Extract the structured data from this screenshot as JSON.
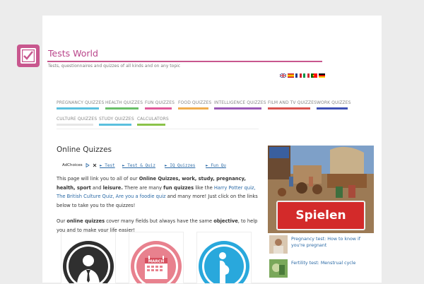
{
  "site": {
    "title": "Tests World",
    "tagline": "Tests, questionnaires and quizzes of all kinds and on any topic"
  },
  "colors": {
    "brand": "#c8578e",
    "link": "#2b6aa6",
    "ad_button": "#d32a2a"
  },
  "languages": [
    "en",
    "es",
    "fr",
    "it",
    "pt",
    "de"
  ],
  "nav": [
    {
      "label": "PREGNANCY QUIZZES",
      "color": "#5bc0de"
    },
    {
      "label": "HEALTH QUIZZES",
      "color": "#6abf69"
    },
    {
      "label": "FUN QUIZZES",
      "color": "#e05a9b"
    },
    {
      "label": "FOOD QUIZZES",
      "color": "#f0ad4e"
    },
    {
      "label": "INTELLIGENCE QUIZZES",
      "color": "#9b59b6"
    },
    {
      "label": "FILM AND TV QUIZZES",
      "color": "#d9534f"
    },
    {
      "label": "WORK QUIZZES",
      "color": "#3f51b5"
    },
    {
      "label": "CULTURE QUIZZES",
      "color": "#e6e6e6"
    },
    {
      "label": "STUDY QUIZZES",
      "color": "#5bc0de"
    },
    {
      "label": "CALCULATORS",
      "color": "#8bc34a"
    }
  ],
  "main": {
    "heading": "Online Quizzes",
    "adchoices": "AdChoices",
    "ad_links": [
      "► Test",
      "► Test & Quiz",
      "► IQ Quizzes",
      "► Fun Qu"
    ],
    "intro": {
      "t1": "This page will link you to all of our ",
      "b1": "Online Quizzes, work, study, pregnancy, health, sport",
      "t2": " and ",
      "b2": "leisure.",
      "t3": " There are many ",
      "b3": "fun quizzes",
      "t4": " like the ",
      "l1": "Harry Potter quiz, The British Culture Quiz, Are you a foodie quiz",
      "t5": " and many more! Just click on the links below to take you to the quizzes!"
    },
    "para2": {
      "t1": "Our ",
      "b1": "online quizzes",
      "t2": " cover many fields but always have the same ",
      "b2": "objective",
      "t3": ", to help you and to make your life easier!"
    },
    "calendar_month": "MARCH"
  },
  "sidebar": {
    "ad_button": "Spielen",
    "links": [
      {
        "text": "Pregnancy test: How to know if you're pregnant"
      },
      {
        "text": "Fertility test: Menstrual cycle"
      }
    ]
  }
}
